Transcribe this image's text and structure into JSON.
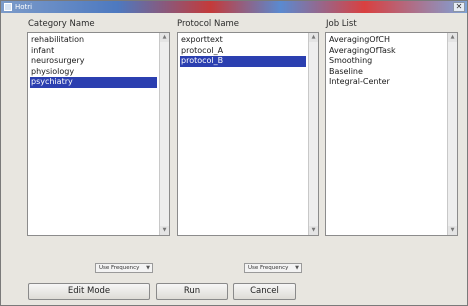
{
  "window": {
    "title": "Hotri"
  },
  "columns": {
    "category": {
      "header": "Category Name",
      "items": [
        "rehabilitation",
        "infant",
        "neurosurgery",
        "physiology",
        "psychiatry"
      ],
      "selected_index": 4
    },
    "protocol": {
      "header": "Protocol Name",
      "items": [
        "exporttext",
        "protocol_A",
        "protocol_B"
      ],
      "selected_index": 2
    },
    "job": {
      "header": "Job List",
      "items": [
        "AveragingOfCH",
        "AveragingOfTask",
        "Smoothing",
        "Baseline",
        "Integral-Center"
      ],
      "selected_index": -1
    }
  },
  "sort_selects": {
    "category": "Use Frequency",
    "protocol": "Use Frequency"
  },
  "buttons": {
    "edit_mode": "Edit Mode",
    "run": "Run",
    "cancel": "Cancel"
  },
  "colors": {
    "selection": "#2b3fb0",
    "window_bg": "#e8e6e0"
  }
}
